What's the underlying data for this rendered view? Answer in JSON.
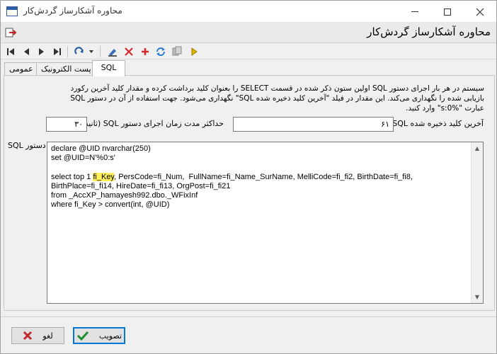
{
  "window": {
    "title": "محاوره آشکارساز گردش‌کار"
  },
  "header": {
    "title": "محاوره آشکارساز گردش‌کار"
  },
  "toolbar": {
    "icons": [
      "first-record-icon",
      "prev-record-icon",
      "next-record-icon",
      "last-record-icon",
      "refresh-dropdown-icon",
      "edit-icon",
      "delete-icon",
      "add-icon",
      "reload-icon",
      "copy-icon",
      "run-icon"
    ]
  },
  "tabs": [
    {
      "label": "SQL",
      "active": true
    },
    {
      "label": "پست الکترونیک",
      "active": false
    },
    {
      "label": "عمومی",
      "active": false
    }
  ],
  "sql_tab": {
    "description": "سیستم در هر بار اجرای دستور SQL اولین ستون ذکر شده در قسمت SELECT را بعنوان کلید برداشت کرده و مقدار کلید آخرین رکورد بازیابی شده را نگهداری می‌کند. این مقدار در فیلد \"آخرین کلید ذخیره شده SQL\" نگهداری می‌شود. جهت استفاده از آن در دستور SQL عبارت \"s:0%\" وارد کنید.",
    "last_key_label": "آخرین کلید ذخیره شده SQL",
    "last_key_value": "۶۱",
    "max_time_label": "حداکثر مدت زمان اجرای دستور SQL (ثانیه)",
    "max_time_value": "۳۰",
    "sql_label": "دستور SQL",
    "sql_lines": [
      "declare @UID nvarchar(250)",
      "set @UID=N'%0:s'",
      "",
      "select top 1 ",
      "BirthPlace=fi_fi14, HireDate=fi_fi13, OrgPost=fi_fi21",
      "from _AccXP_hamayesh992.dbo._WFixInf",
      "where fi_Key > convert(int, @UID)"
    ],
    "sql_line4_highlight": "fi_Key",
    "sql_line4_rest": ", PersCode=fi_Num,  FullName=fi_Name_SurName, MelliCode=fi_fi2, BirthDate=fi_fi8,"
  },
  "footer": {
    "ok_label": "تصویب",
    "cancel_label": "لغو"
  },
  "colors": {
    "highlight": "#ffef5a",
    "ok_check": "#1f8f2e",
    "cancel_x": "#c0282a"
  }
}
